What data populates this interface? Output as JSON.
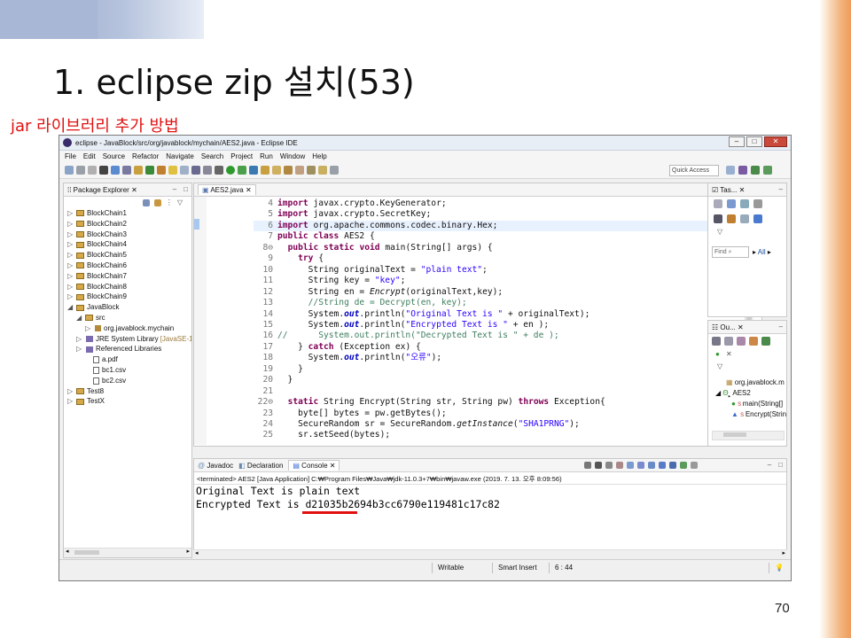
{
  "slide": {
    "title": "1. eclipse zip 설치(53)",
    "subtitle": "jar 라이브러리 추가 방법",
    "page_number": "70"
  },
  "window": {
    "title": "eclipse - JavaBlock/src/org/javablock/mychain/AES2.java - Eclipse IDE",
    "menu": [
      "File",
      "Edit",
      "Source",
      "Refactor",
      "Navigate",
      "Search",
      "Project",
      "Run",
      "Window",
      "Help"
    ],
    "quick_access": "Quick Access"
  },
  "package_explorer": {
    "tab": "Package Explorer",
    "items": [
      {
        "label": "BlockChain1",
        "kind": "project",
        "twisty": "▷"
      },
      {
        "label": "BlockChain2",
        "kind": "project",
        "twisty": "▷"
      },
      {
        "label": "BlockChain3",
        "kind": "project",
        "twisty": "▷"
      },
      {
        "label": "BlockChain4",
        "kind": "project",
        "twisty": "▷"
      },
      {
        "label": "BlockChain5",
        "kind": "project",
        "twisty": "▷"
      },
      {
        "label": "BlockChain6",
        "kind": "project",
        "twisty": "▷"
      },
      {
        "label": "BlockChain7",
        "kind": "project",
        "twisty": "▷"
      },
      {
        "label": "BlockChain8",
        "kind": "project",
        "twisty": "▷"
      },
      {
        "label": "BlockChain9",
        "kind": "project",
        "twisty": "▷"
      },
      {
        "label": "JavaBlock",
        "kind": "project",
        "twisty": "◢"
      },
      {
        "label": "src",
        "kind": "folder",
        "twisty": "◢"
      },
      {
        "label": "org.javablock.mychain",
        "kind": "package",
        "twisty": "▷"
      },
      {
        "label": "JRE System Library",
        "kind": "library",
        "twisty": "▷",
        "suffix": "[JavaSE-1"
      },
      {
        "label": "Referenced Libraries",
        "kind": "library",
        "twisty": "▷"
      },
      {
        "label": "a.pdf",
        "kind": "file",
        "twisty": ""
      },
      {
        "label": "bc1.csv",
        "kind": "file",
        "twisty": ""
      },
      {
        "label": "bc2.csv",
        "kind": "file",
        "twisty": ""
      },
      {
        "label": "Test8",
        "kind": "project",
        "twisty": "▷"
      },
      {
        "label": "TestX",
        "kind": "project",
        "twisty": "▷"
      }
    ]
  },
  "editor": {
    "tab": "AES2.java",
    "lines": [
      {
        "n": "4",
        "code": "import javax.crypto.KeyGenerator;"
      },
      {
        "n": "5",
        "code": "import javax.crypto.SecretKey;"
      },
      {
        "n": "6",
        "code": "import org.apache.commons.codec.binary.Hex;"
      },
      {
        "n": "7",
        "code": "public class AES2 {"
      },
      {
        "n": "8⊖",
        "code": "  public static void main(String[] args) {"
      },
      {
        "n": "9",
        "code": "    try {"
      },
      {
        "n": "10",
        "code": "      String originalText = \"plain text\";"
      },
      {
        "n": "11",
        "code": "      String key = \"key\";"
      },
      {
        "n": "12",
        "code": "      String en = Encrypt(originalText,key);"
      },
      {
        "n": "13",
        "code": "      //String de = Decrypt(en, key);"
      },
      {
        "n": "14",
        "code": "      System.out.println(\"Original Text is \" + originalText);"
      },
      {
        "n": "15",
        "code": "      System.out.println(\"Encrypted Text is \" + en );"
      },
      {
        "n": "16",
        "code": "//      System.out.println(\"Decrypted Text is \" + de );"
      },
      {
        "n": "17",
        "code": "    } catch (Exception ex) {"
      },
      {
        "n": "18",
        "code": "      System.out.println(\"오류\");"
      },
      {
        "n": "19",
        "code": "    }"
      },
      {
        "n": "20",
        "code": "  }"
      },
      {
        "n": "21",
        "code": ""
      },
      {
        "n": "22⊖",
        "code": "  static String Encrypt(String str, String pw) throws Exception{"
      },
      {
        "n": "23",
        "code": "    byte[] bytes = pw.getBytes();"
      },
      {
        "n": "24",
        "code": "    SecureRandom sr = SecureRandom.getInstance(\"SHA1PRNG\");"
      },
      {
        "n": "25",
        "code": "    sr.setSeed(bytes);"
      }
    ]
  },
  "task_list": {
    "tab": "Tas...",
    "find_placeholder": "Find",
    "all_label": "All"
  },
  "outline": {
    "tab": "Ou...",
    "items": [
      "org.javablock.m",
      "AES2",
      "main(String[]",
      "Encrypt(Strin"
    ]
  },
  "console": {
    "tabs": [
      "Javadoc",
      "Declaration",
      "Console"
    ],
    "terminated": "<terminated> AES2 [Java Application] C:₩Program Files₩Java₩jdk-11.0.3+7₩bin₩javaw.exe (2019. 7. 13. 오후 8:09:56)",
    "output_line1": "Original Text is plain text",
    "output_line2": "Encrypted Text is d21035b2694b3cc6790e119481c17c82"
  },
  "status": {
    "writable": "Writable",
    "insert_mode": "Smart Insert",
    "position": "6 : 44"
  },
  "colors": {
    "keyword": "#7f0055",
    "string": "#2a00ff",
    "comment": "#3f7f5f",
    "underline_red": "#e01010"
  }
}
